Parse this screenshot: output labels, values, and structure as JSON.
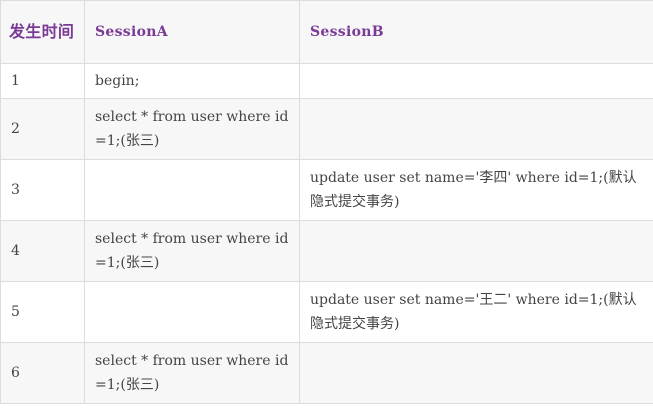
{
  "table": {
    "headers": [
      "发生时间",
      "SessionA",
      "SessionB"
    ],
    "rows": [
      {
        "time": "1",
        "session_a": "begin;",
        "session_b": ""
      },
      {
        "time": "2",
        "session_a": "select * from user where id=1;(张三)",
        "session_b": ""
      },
      {
        "time": "3",
        "session_a": "",
        "session_b": "update user set name='李四' where id=1;(默认隐式提交事务)"
      },
      {
        "time": "4",
        "session_a": "select * from user where id=1;(张三)",
        "session_b": ""
      },
      {
        "time": "5",
        "session_a": "",
        "session_b": "update user set name='王二' where id=1;(默认隐式提交事务)"
      },
      {
        "time": "6",
        "session_a": "select * from user where id=1;(张三)",
        "session_b": ""
      }
    ]
  },
  "colors": {
    "header_text": "#7a3a96",
    "body_text": "#444444",
    "border": "#dcdcdc",
    "stripe": "#f7f7f7"
  }
}
